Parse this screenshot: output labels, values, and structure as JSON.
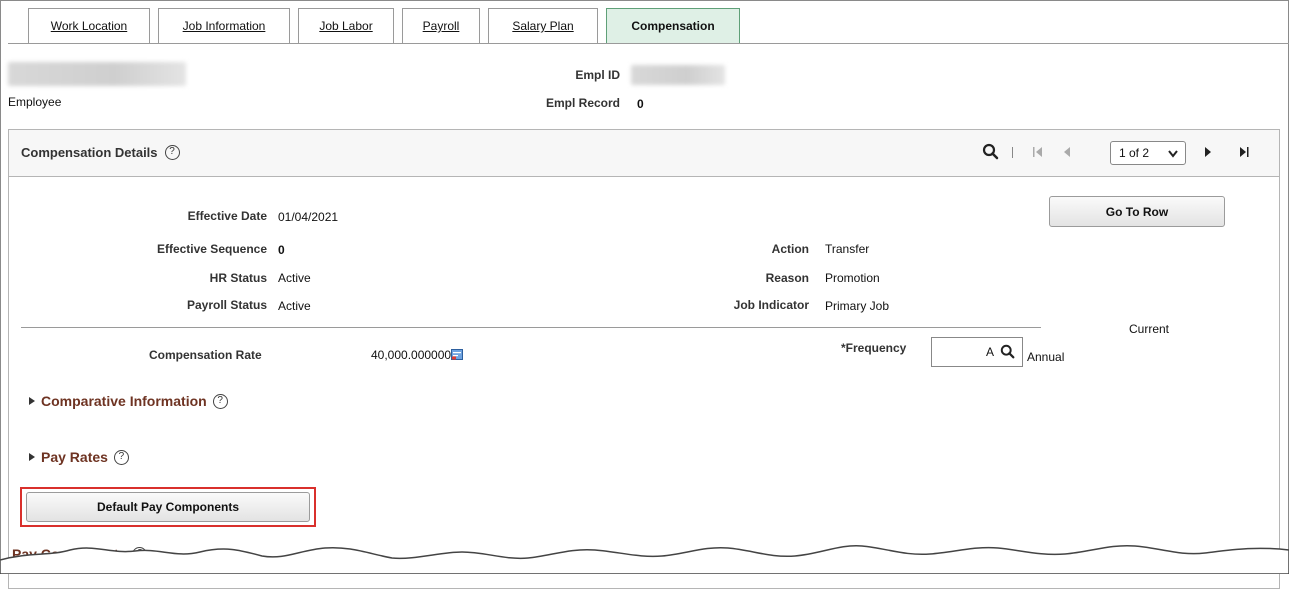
{
  "tabs": [
    {
      "label": "Work Location"
    },
    {
      "label": "Job Information"
    },
    {
      "label": "Job Labor"
    },
    {
      "label": "Payroll"
    },
    {
      "label": "Salary Plan"
    },
    {
      "label": "Compensation"
    }
  ],
  "header": {
    "employee_label": "Employee",
    "empl_id_label": "Empl ID",
    "empl_record_label": "Empl Record",
    "empl_record_value": "0"
  },
  "panel": {
    "title": "Compensation Details",
    "help": "?",
    "pager": {
      "value": "1 of 2"
    },
    "go_to_row": "Go To Row",
    "effective_date_label": "Effective Date",
    "effective_date": "01/04/2021",
    "effective_sequence_label": "Effective Sequence",
    "effective_sequence": "0",
    "hr_status_label": "HR Status",
    "hr_status": "Active",
    "payroll_status_label": "Payroll Status",
    "payroll_status": "Active",
    "action_label": "Action",
    "action": "Transfer",
    "reason_label": "Reason",
    "reason": "Promotion",
    "job_indicator_label": "Job Indicator",
    "job_indicator": "Primary Job",
    "current_label": "Current",
    "comp_rate_label": "Compensation Rate",
    "comp_rate": "40,000.000000",
    "frequency_label": "*Frequency",
    "frequency_value": "A",
    "frequency_desc": "Annual",
    "comparative_info": "Comparative Information",
    "pay_rates": "Pay Rates",
    "default_pay_components": "Default Pay Components",
    "pay_components": "Pay Components"
  },
  "colors": {
    "active_tab_bg": "#dff0e6",
    "section_link": "#6e3322",
    "highlight_box": "#d9302c"
  }
}
